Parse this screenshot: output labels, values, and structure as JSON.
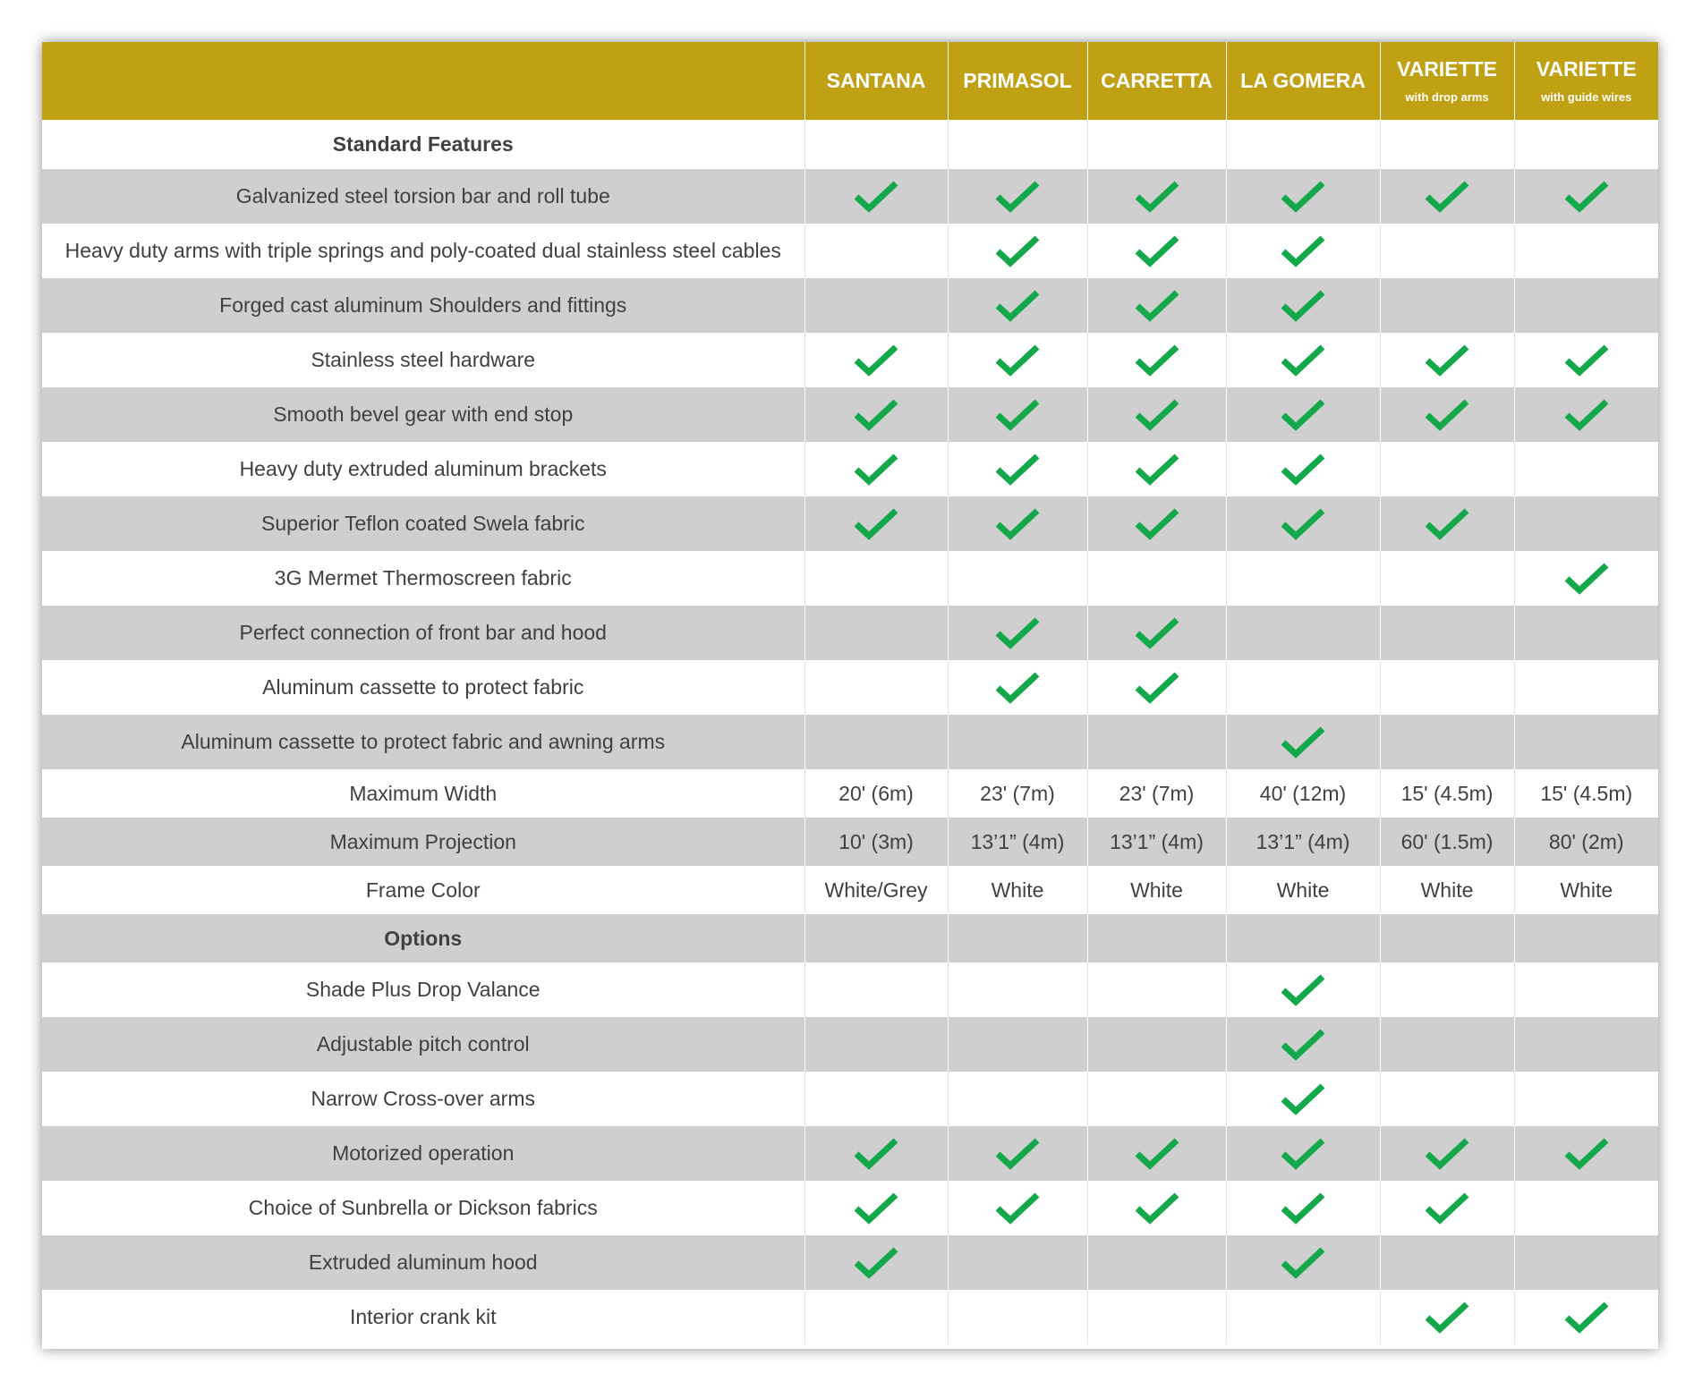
{
  "columns": [
    {
      "name": "SANTANA",
      "sub": ""
    },
    {
      "name": "PRIMASOL",
      "sub": ""
    },
    {
      "name": "CARRETTA",
      "sub": ""
    },
    {
      "name": "LA GOMERA",
      "sub": ""
    },
    {
      "name": "VARIETTE",
      "sub": "with drop arms"
    },
    {
      "name": "VARIETTE",
      "sub": "with guide wires"
    }
  ],
  "colors": {
    "header": "#c1a114",
    "stripe": "#cfcfcf",
    "check": "#13a84a"
  },
  "check_icon": "checkmark-icon",
  "rows": [
    {
      "kind": "section",
      "label": "Standard Features",
      "bg": "w",
      "h": 55
    },
    {
      "kind": "check",
      "label": "Galvanized steel torsion bar and roll tube",
      "bg": "g",
      "h": 61,
      "checks": [
        true,
        true,
        true,
        true,
        true,
        true
      ]
    },
    {
      "kind": "check",
      "label": "Heavy duty arms with triple springs and poly-coated dual stainless steel cables",
      "bg": "w",
      "h": 61,
      "checks": [
        false,
        true,
        true,
        true,
        false,
        false
      ]
    },
    {
      "kind": "check",
      "label": "Forged cast aluminum Shoulders and fittings",
      "bg": "g",
      "h": 61,
      "checks": [
        false,
        true,
        true,
        true,
        false,
        false
      ]
    },
    {
      "kind": "check",
      "label": "Stainless steel hardware",
      "bg": "w",
      "h": 61,
      "checks": [
        true,
        true,
        true,
        true,
        true,
        true
      ]
    },
    {
      "kind": "check",
      "label": "Smooth bevel gear with end stop",
      "bg": "g",
      "h": 61,
      "checks": [
        true,
        true,
        true,
        true,
        true,
        true
      ]
    },
    {
      "kind": "check",
      "label": "Heavy duty extruded aluminum brackets",
      "bg": "w",
      "h": 61,
      "checks": [
        true,
        true,
        true,
        true,
        false,
        false
      ]
    },
    {
      "kind": "check",
      "label": "Superior Teflon coated Swela fabric",
      "bg": "g",
      "h": 61,
      "checks": [
        true,
        true,
        true,
        true,
        true,
        false
      ]
    },
    {
      "kind": "check",
      "label": "3G Mermet Thermoscreen fabric",
      "bg": "w",
      "h": 61,
      "checks": [
        false,
        false,
        false,
        false,
        false,
        true
      ]
    },
    {
      "kind": "check",
      "label": "Perfect connection of front bar and hood",
      "bg": "g",
      "h": 61,
      "checks": [
        false,
        true,
        true,
        false,
        false,
        false
      ]
    },
    {
      "kind": "check",
      "label": "Aluminum cassette to protect fabric",
      "bg": "w",
      "h": 61,
      "checks": [
        false,
        true,
        true,
        false,
        false,
        false
      ]
    },
    {
      "kind": "check",
      "label": "Aluminum cassette to protect fabric and awning arms",
      "bg": "g",
      "h": 61,
      "checks": [
        false,
        false,
        false,
        true,
        false,
        false
      ]
    },
    {
      "kind": "text",
      "label": "Maximum Width",
      "bg": "w",
      "h": 54,
      "values": [
        "20' (6m)",
        "23' (7m)",
        "23' (7m)",
        "40' (12m)",
        "15' (4.5m)",
        "15' (4.5m)"
      ]
    },
    {
      "kind": "text",
      "label": "Maximum Projection",
      "bg": "g",
      "h": 54,
      "values": [
        "10' (3m)",
        "13’1” (4m)",
        "13’1” (4m)",
        "13’1” (4m)",
        "60' (1.5m)",
        "80' (2m)"
      ]
    },
    {
      "kind": "text",
      "label": "Frame Color",
      "bg": "w",
      "h": 54,
      "values": [
        "White/Grey",
        "White",
        "White",
        "White",
        "White",
        "White"
      ]
    },
    {
      "kind": "section",
      "label": "Options",
      "bg": "g",
      "h": 54
    },
    {
      "kind": "check",
      "label": "Shade Plus Drop Valance",
      "bg": "w",
      "h": 61,
      "checks": [
        false,
        false,
        false,
        true,
        false,
        false
      ]
    },
    {
      "kind": "check",
      "label": "Adjustable pitch control",
      "bg": "g",
      "h": 61,
      "checks": [
        false,
        false,
        false,
        true,
        false,
        false
      ]
    },
    {
      "kind": "check",
      "label": "Narrow Cross-over arms",
      "bg": "w",
      "h": 61,
      "checks": [
        false,
        false,
        false,
        true,
        false,
        false
      ]
    },
    {
      "kind": "check",
      "label": "Motorized operation",
      "bg": "g",
      "h": 61,
      "checks": [
        true,
        true,
        true,
        true,
        true,
        true
      ]
    },
    {
      "kind": "check",
      "label": "Choice of Sunbrella or Dickson fabrics",
      "bg": "w",
      "h": 61,
      "checks": [
        true,
        true,
        true,
        true,
        true,
        false
      ]
    },
    {
      "kind": "check",
      "label": "Extruded aluminum hood",
      "bg": "g",
      "h": 61,
      "checks": [
        true,
        false,
        false,
        true,
        false,
        false
      ]
    },
    {
      "kind": "check",
      "label": "Interior crank kit",
      "bg": "w",
      "h": 61,
      "checks": [
        false,
        false,
        false,
        false,
        true,
        true
      ]
    }
  ]
}
